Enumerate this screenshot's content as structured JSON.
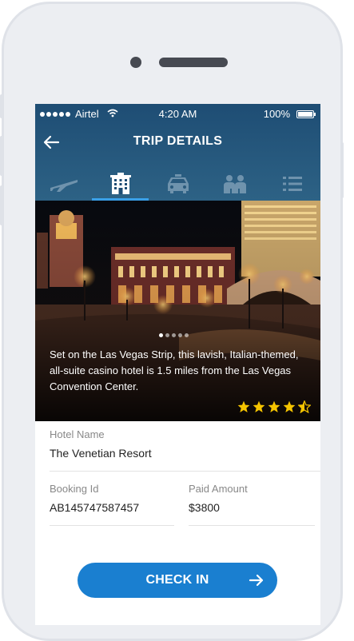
{
  "status_bar": {
    "carrier": "Airtel",
    "time": "4:20 AM",
    "battery": "100%"
  },
  "header": {
    "title": "TRIP DETAILS",
    "back_icon": "back-arrow-icon"
  },
  "tabs": [
    {
      "icon": "flight-icon",
      "active": false
    },
    {
      "icon": "hotel-icon",
      "active": true
    },
    {
      "icon": "taxi-icon",
      "active": false
    },
    {
      "icon": "people-icon",
      "active": false
    },
    {
      "icon": "list-icon",
      "active": false
    }
  ],
  "hero": {
    "description": "Set on the Las Vegas Strip, this lavish, Italian-themed, all-suite casino hotel is 1.5 miles from the Las Vegas Convention Center.",
    "pager": {
      "total": 5,
      "active_index": 0
    },
    "rating": {
      "value": 4.5,
      "max": 5
    }
  },
  "details": {
    "hotel_name_label": "Hotel Name",
    "hotel_name": "The Venetian Resort",
    "booking_id_label": "Booking Id",
    "booking_id": "AB145747587457",
    "paid_amount_label": "Paid Amount",
    "paid_amount": "$3800"
  },
  "cta": {
    "label": "CHECK IN"
  },
  "colors": {
    "header": "#1e4d74",
    "tab_indicator": "#3aa0e8",
    "button": "#1a7fd0",
    "stars": "#f5c400"
  }
}
